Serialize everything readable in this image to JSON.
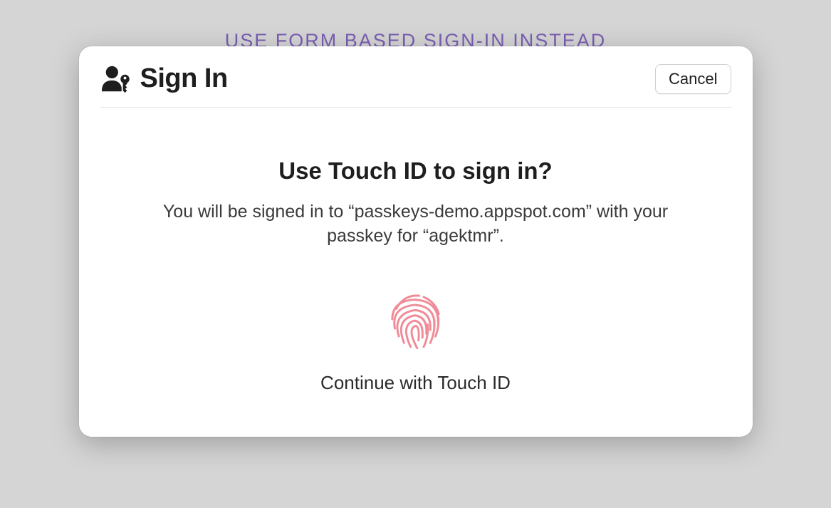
{
  "background": {
    "link_text": "USE FORM BASED SIGN-IN INSTEAD"
  },
  "dialog": {
    "title": "Sign In",
    "cancel_label": "Cancel",
    "prompt_title": "Use Touch ID to sign in?",
    "prompt_description": "You will be signed in to “passkeys-demo.appspot.com” with your passkey for “agektmr”.",
    "continue_label": "Continue with Touch ID"
  },
  "colors": {
    "link": "#7b5fb3",
    "fingerprint": "#f08b97"
  }
}
